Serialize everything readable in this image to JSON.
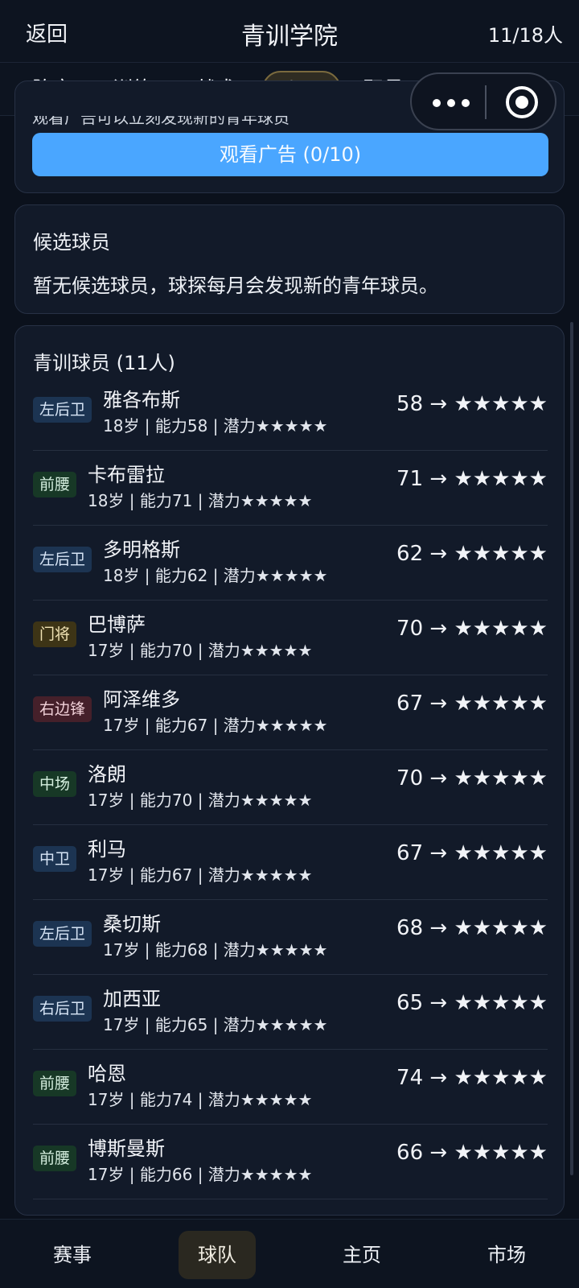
{
  "header": {
    "back": "返回",
    "title": "青训学院",
    "count": "11/18人"
  },
  "tabs": [
    {
      "label": "阵容"
    },
    {
      "label": "训练"
    },
    {
      "label": "战术"
    },
    {
      "label": "青训",
      "active": true
    },
    {
      "label": "职员"
    }
  ],
  "capsule": {
    "more_icon": "more-dots-icon",
    "close_icon": "target-circle-icon"
  },
  "ad_card": {
    "cut_text": "观看广告可以立刻发现新的青年球员",
    "button_label": "观看广告 (0/10)"
  },
  "candidates": {
    "title": "候选球员",
    "message": "暂无候选球员，球探每月会发现新的青年球员。"
  },
  "youth": {
    "title": "青训球员 (11人)",
    "players": [
      {
        "pos": "左后卫",
        "pos_color": "blue",
        "name": "雅各布斯",
        "detail": "18岁 | 能力58 | 潜力★★★★★",
        "rating": "58 → ★★★★★"
      },
      {
        "pos": "前腰",
        "pos_color": "green",
        "name": "卡布雷拉",
        "detail": "18岁 | 能力71 | 潜力★★★★★",
        "rating": "71 → ★★★★★"
      },
      {
        "pos": "左后卫",
        "pos_color": "blue",
        "name": "多明格斯",
        "detail": "18岁 | 能力62 | 潜力★★★★★",
        "rating": "62 → ★★★★★"
      },
      {
        "pos": "门将",
        "pos_color": "gold",
        "name": "巴博萨",
        "detail": "17岁 | 能力70 | 潜力★★★★★",
        "rating": "70 → ★★★★★"
      },
      {
        "pos": "右边锋",
        "pos_color": "red",
        "name": "阿泽维多",
        "detail": "17岁 | 能力67 | 潜力★★★★★",
        "rating": "67 → ★★★★★"
      },
      {
        "pos": "中场",
        "pos_color": "green",
        "name": "洛朗",
        "detail": "17岁 | 能力70 | 潜力★★★★★",
        "rating": "70 → ★★★★★"
      },
      {
        "pos": "中卫",
        "pos_color": "blue",
        "name": "利马",
        "detail": "17岁 | 能力67 | 潜力★★★★★",
        "rating": "67 → ★★★★★"
      },
      {
        "pos": "左后卫",
        "pos_color": "blue",
        "name": "桑切斯",
        "detail": "17岁 | 能力68 | 潜力★★★★★",
        "rating": "68 → ★★★★★"
      },
      {
        "pos": "右后卫",
        "pos_color": "blue",
        "name": "加西亚",
        "detail": "17岁 | 能力65 | 潜力★★★★★",
        "rating": "65 → ★★★★★"
      },
      {
        "pos": "前腰",
        "pos_color": "green",
        "name": "哈恩",
        "detail": "17岁 | 能力74 | 潜力★★★★★",
        "rating": "74 → ★★★★★"
      },
      {
        "pos": "前腰",
        "pos_color": "green",
        "name": "博斯曼斯",
        "detail": "17岁 | 能力66 | 潜力★★★★★",
        "rating": "66 → ★★★★★"
      }
    ]
  },
  "bottom_nav": [
    {
      "label": "赛事"
    },
    {
      "label": "球队",
      "active": true
    },
    {
      "label": "主页"
    },
    {
      "label": "市场"
    }
  ]
}
